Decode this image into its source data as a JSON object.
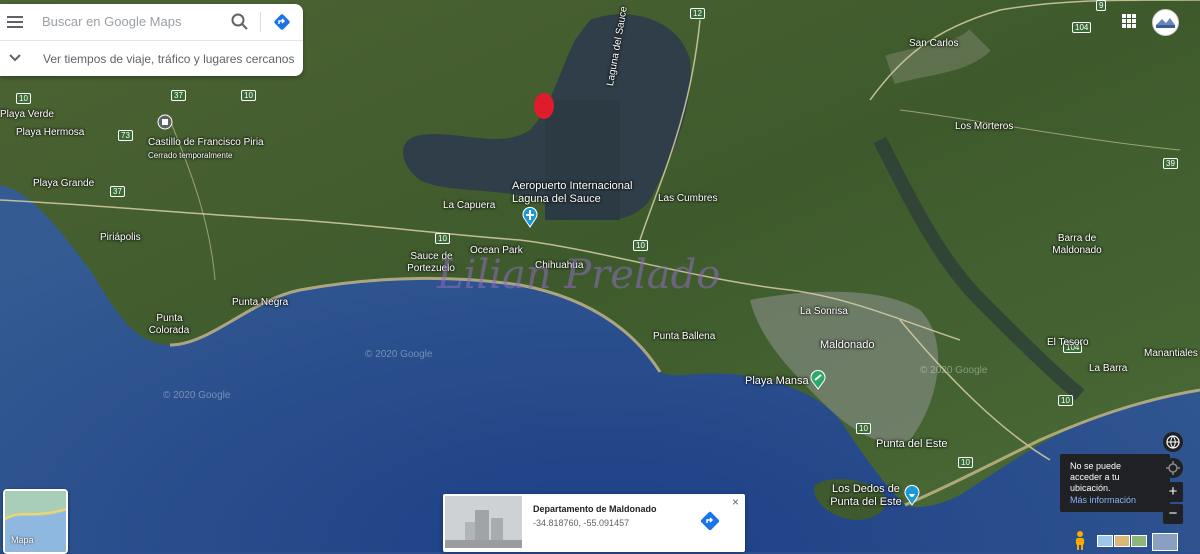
{
  "search": {
    "placeholder": "Buscar en Google Maps",
    "nearby_label": "Ver tiempos de viaje, tráfico y lugares cercanos"
  },
  "map": {
    "places": {
      "piria": "Castillo de Francisco Piria",
      "piria_status": "Cerrado temporalmente",
      "airport_line1": "Aeropuerto Internacional",
      "airport_line2": "Laguna del Sauce",
      "laguna": "Laguna del Sauce",
      "san_carlos": "San Carlos",
      "los_morteros": "Los Morteros",
      "playa_verde": "Playa Verde",
      "playa_hermosa": "Playa Hermosa",
      "playa_grande": "Playa Grande",
      "piriapolis": "Piriápolis",
      "punta_negra": "Punta Negra",
      "punta_colorada_1": "Punta",
      "punta_colorada_2": "Colorada",
      "la_capuera": "La Capuera",
      "las_cumbres": "Las Cumbres",
      "ocean_park": "Ocean Park",
      "sauce_1": "Sauce de",
      "sauce_2": "Portezuelo",
      "chihuahua": "Chihuahua",
      "punta_ballena": "Punta Ballena",
      "la_sonrisa": "La Sonrisa",
      "maldonado": "Maldonado",
      "playa_mansa": "Playa Mansa",
      "punta_del_este": "Punta del Este",
      "dedos_1": "Los Dedos de",
      "dedos_2": "Punta del Este",
      "barra_1": "Barra de",
      "barra_2": "Maldonado",
      "el_tesoro": "El Tesoro",
      "la_barra": "La Barra",
      "manantiales": "Manantiales"
    },
    "routes": [
      "12",
      "10",
      "37",
      "73",
      "104",
      "9",
      "39"
    ],
    "watermark_map": "© 2020 Google",
    "watermark_photo": "Lilian Prelado"
  },
  "card": {
    "title": "Departamento de Maldonado",
    "coords": "-34.818760, -55.091457",
    "close": "×"
  },
  "layers": {
    "label": "Mapa"
  },
  "location_popup": {
    "text": "No se puede acceder a tu ubicación.",
    "more": "Más información"
  },
  "controls": {
    "zoom_in": "+",
    "zoom_out": "−"
  },
  "colors": {
    "ocean": "#2b4f8f",
    "land": "#3f5a2e",
    "directions": "#4285f4"
  }
}
